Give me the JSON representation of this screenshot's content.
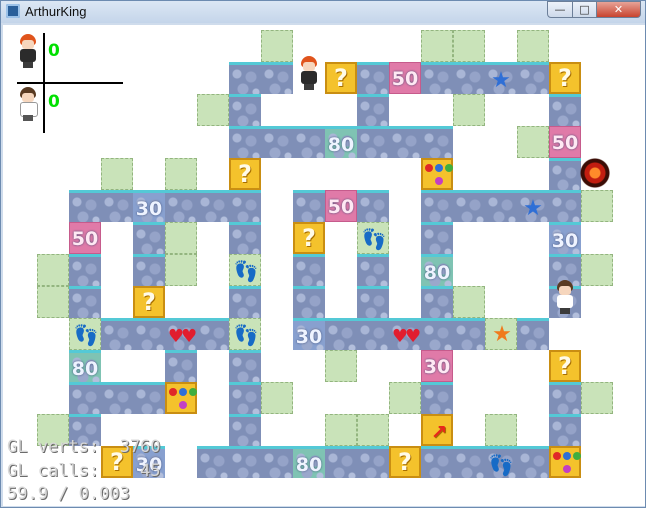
{
  "window": {
    "title": "ArthurKing",
    "buttons": {
      "minimize": "—",
      "maximize": "□",
      "close": "✕"
    }
  },
  "hud": {
    "players": [
      {
        "name": "player-boy",
        "score": "0"
      },
      {
        "name": "player-girl",
        "score": "0"
      }
    ]
  },
  "debug": {
    "line1": "GL verts:  3760",
    "line2": "GL calls:    45",
    "line3": "59.9 / 0.003"
  },
  "tiles": {
    "numbers": [
      "50",
      "80",
      "30",
      "50",
      "30",
      "50",
      "30",
      "80",
      "30",
      "50",
      "80",
      "30",
      "80"
    ],
    "question": "?"
  },
  "colors": {
    "hud_score": "#00e000",
    "path_edge": "#54c9d6",
    "grass": "#c9e3b9"
  }
}
